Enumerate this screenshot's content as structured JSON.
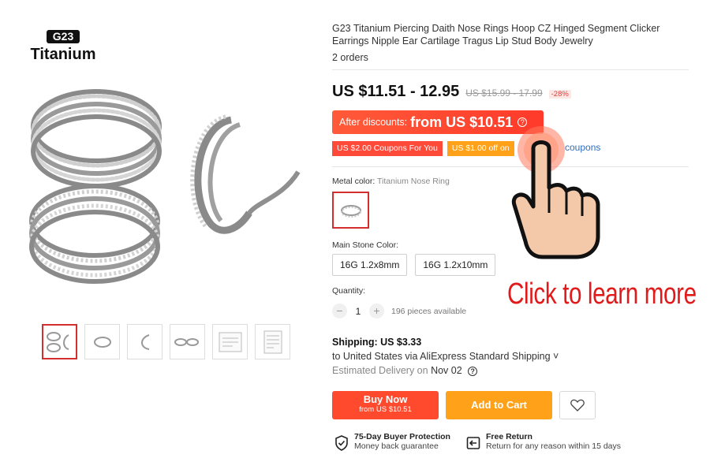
{
  "brand": {
    "badge": "G23",
    "name": "Titanium"
  },
  "product": {
    "title": "G23 Titanium Piercing Daith Nose Rings Hoop CZ Hinged Segment Clicker Earrings Nipple Ear Cartilage Tragus Lip Stud Body Jewelry",
    "orders": "2 orders"
  },
  "price": {
    "current": "US $11.51 - 12.95",
    "original": "US $15.99 - 17.99",
    "discount_pct": "-28%"
  },
  "discount_banner": {
    "label": "After discounts:",
    "value": "from US $10.51",
    "icon": "info-icon"
  },
  "coupons": {
    "items": [
      "US $2.00 Coupons For You",
      "US $1.00 off on"
    ],
    "link": "coupons"
  },
  "options": {
    "metal_label": "Metal color:",
    "metal_value": "Titanium Nose Ring",
    "stone_label": "Main Stone Color:",
    "sizes": [
      "16G 1.2x8mm",
      "16G 1.2x10mm"
    ]
  },
  "quantity": {
    "label": "Quantity:",
    "minus": "−",
    "value": "1",
    "plus": "+",
    "available": "196 pieces available"
  },
  "shipping": {
    "title": "Shipping: US $3.33",
    "method": "to United States via AliExpress Standard Shipping ˅",
    "est_label": "Estimated Delivery on",
    "est_date": "Nov 02"
  },
  "actions": {
    "buy_now": "Buy Now",
    "buy_now_sub": "from US $10.51",
    "add_to_cart": "Add to Cart",
    "wishlist_icon": "heart-icon"
  },
  "guarantees": [
    {
      "title": "75-Day Buyer Protection",
      "sub": "Money back guarantee",
      "icon": "shield-check-icon"
    },
    {
      "title": "Free Return",
      "sub": "Return for any reason within 15 days",
      "icon": "return-icon"
    }
  ],
  "overlay": {
    "cta": "Click to learn more",
    "icon": "pointing-hand-icon"
  },
  "colors": {
    "accent_red": "#ff4a2e",
    "accent_orange": "#ffa21a",
    "cta_red": "#e11b1b",
    "link_blue": "#2f6fbf"
  }
}
